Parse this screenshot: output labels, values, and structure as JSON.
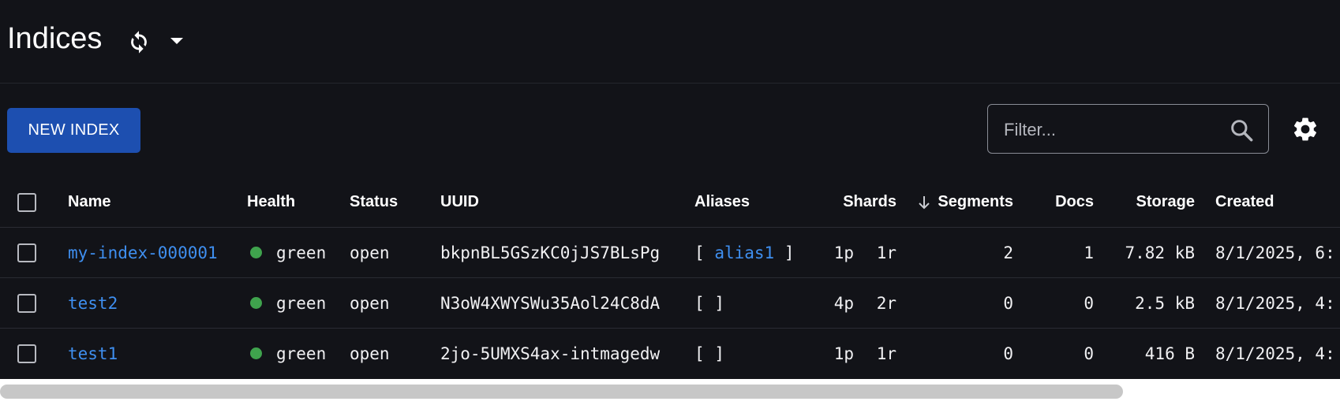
{
  "page": {
    "title": "Indices"
  },
  "toolbar": {
    "new_index_label": "NEW INDEX",
    "filter_placeholder": "Filter..."
  },
  "table": {
    "headers": {
      "name": "Name",
      "health": "Health",
      "status": "Status",
      "uuid": "UUID",
      "aliases": "Aliases",
      "shards": "Shards",
      "segments": "Segments",
      "docs": "Docs",
      "storage": "Storage",
      "created": "Created"
    },
    "sort": {
      "column": "segments",
      "direction": "descending"
    },
    "rows": [
      {
        "name": "my-index-000001",
        "health": "green",
        "status": "open",
        "uuid": "bkpnBL5GSzKC0jJS7BLsPg",
        "alias_open": "[",
        "aliases": "alias1",
        "alias_close": "]",
        "primary": "1p",
        "replica": "1r",
        "segments": "2",
        "docs": "1",
        "storage": "7.82 kB",
        "created": "8/1/2025, 6:"
      },
      {
        "name": "test2",
        "health": "green",
        "status": "open",
        "uuid": "N3oW4XWYSWu35Aol24C8dA",
        "alias_open": "[",
        "aliases": "",
        "alias_close": "]",
        "primary": "4p",
        "replica": "2r",
        "segments": "0",
        "docs": "0",
        "storage": "2.5 kB",
        "created": "8/1/2025, 4:"
      },
      {
        "name": "test1",
        "health": "green",
        "status": "open",
        "uuid": "2jo-5UMXS4ax-intmagedw",
        "alias_open": "[",
        "aliases": "",
        "alias_close": "]",
        "primary": "1p",
        "replica": "1r",
        "segments": "0",
        "docs": "0",
        "storage": "416 B",
        "created": "8/1/2025, 4:"
      }
    ]
  },
  "colors": {
    "background": "#121318",
    "accent": "#1d4fb0",
    "link": "#3f8ff0",
    "health_green": "#3fa34d"
  },
  "icons": {
    "refresh": "refresh-icon",
    "dropdown": "chevron-down-icon",
    "search": "search-icon",
    "settings": "gear-icon",
    "sort": "arrow-down-icon"
  }
}
